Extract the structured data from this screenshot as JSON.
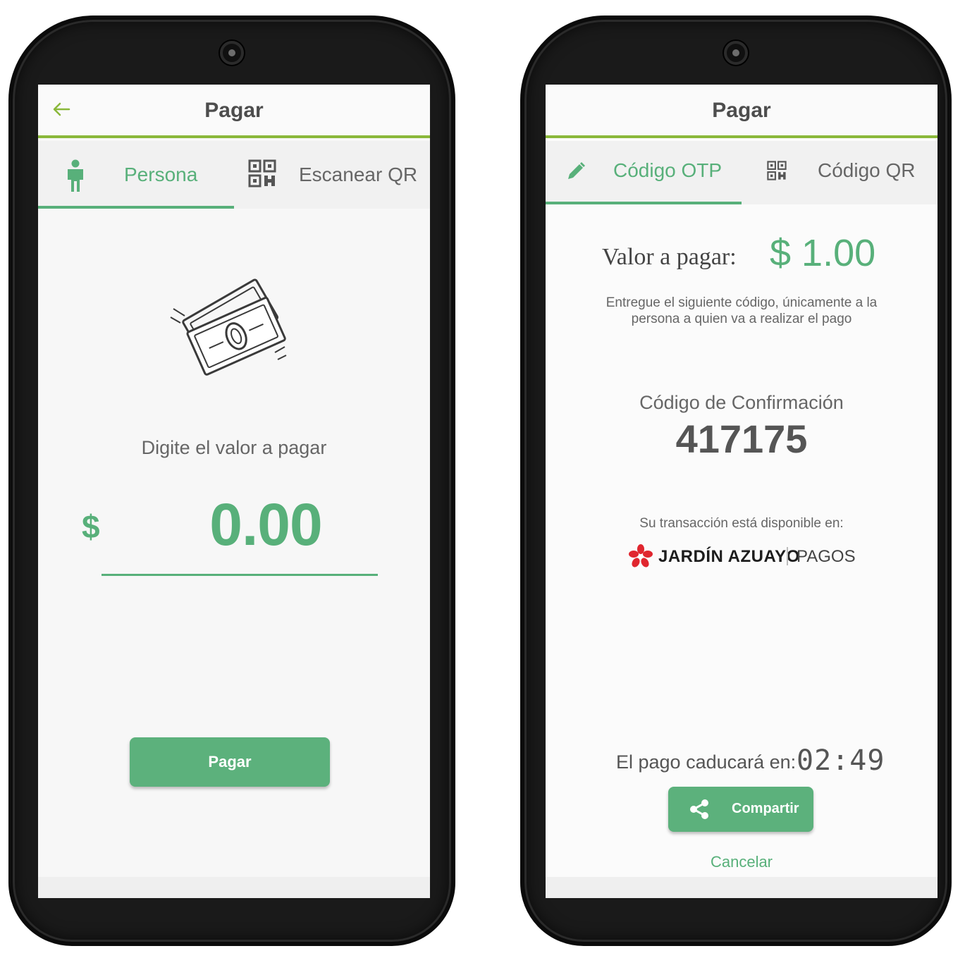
{
  "left_phone": {
    "header": {
      "title": "Pagar"
    },
    "tabs": [
      {
        "label": "Persona",
        "icon": "person-icon",
        "active": true
      },
      {
        "label": "Escanear QR",
        "icon": "qr-code-icon",
        "active": false
      }
    ],
    "prompt": "Digite el valor a pagar",
    "amount": {
      "currency": "$",
      "value": "0.00"
    },
    "pay_button": {
      "label": "Pagar"
    }
  },
  "right_phone": {
    "header": {
      "title": "Pagar"
    },
    "tabs": [
      {
        "label": "Código OTP",
        "icon": "pencil-icon",
        "active": true
      },
      {
        "label": "Código QR",
        "icon": "qr-code-icon",
        "active": false
      }
    ],
    "value": {
      "label": "Valor a pagar:",
      "amount": "$ 1.00"
    },
    "instructions": "Entregue el siguiente código, únicamente a la persona a quien va a realizar el pago",
    "confirmation": {
      "label": "Código de Confirmación",
      "code": "417175"
    },
    "availability": {
      "label": "Su transacción está disponible en:",
      "brand_name": "JARDÍN AZUAYO",
      "brand_sub": "PAGOS"
    },
    "expiration": {
      "label": "El pago caducará en:",
      "timer": "02:49"
    },
    "share_button": {
      "label": "Compartir"
    },
    "cancel_link": {
      "label": "Cancelar"
    }
  },
  "colors": {
    "accent_green": "#58b07a",
    "header_line": "#8ab83a",
    "brand_red": "#e0262f"
  }
}
